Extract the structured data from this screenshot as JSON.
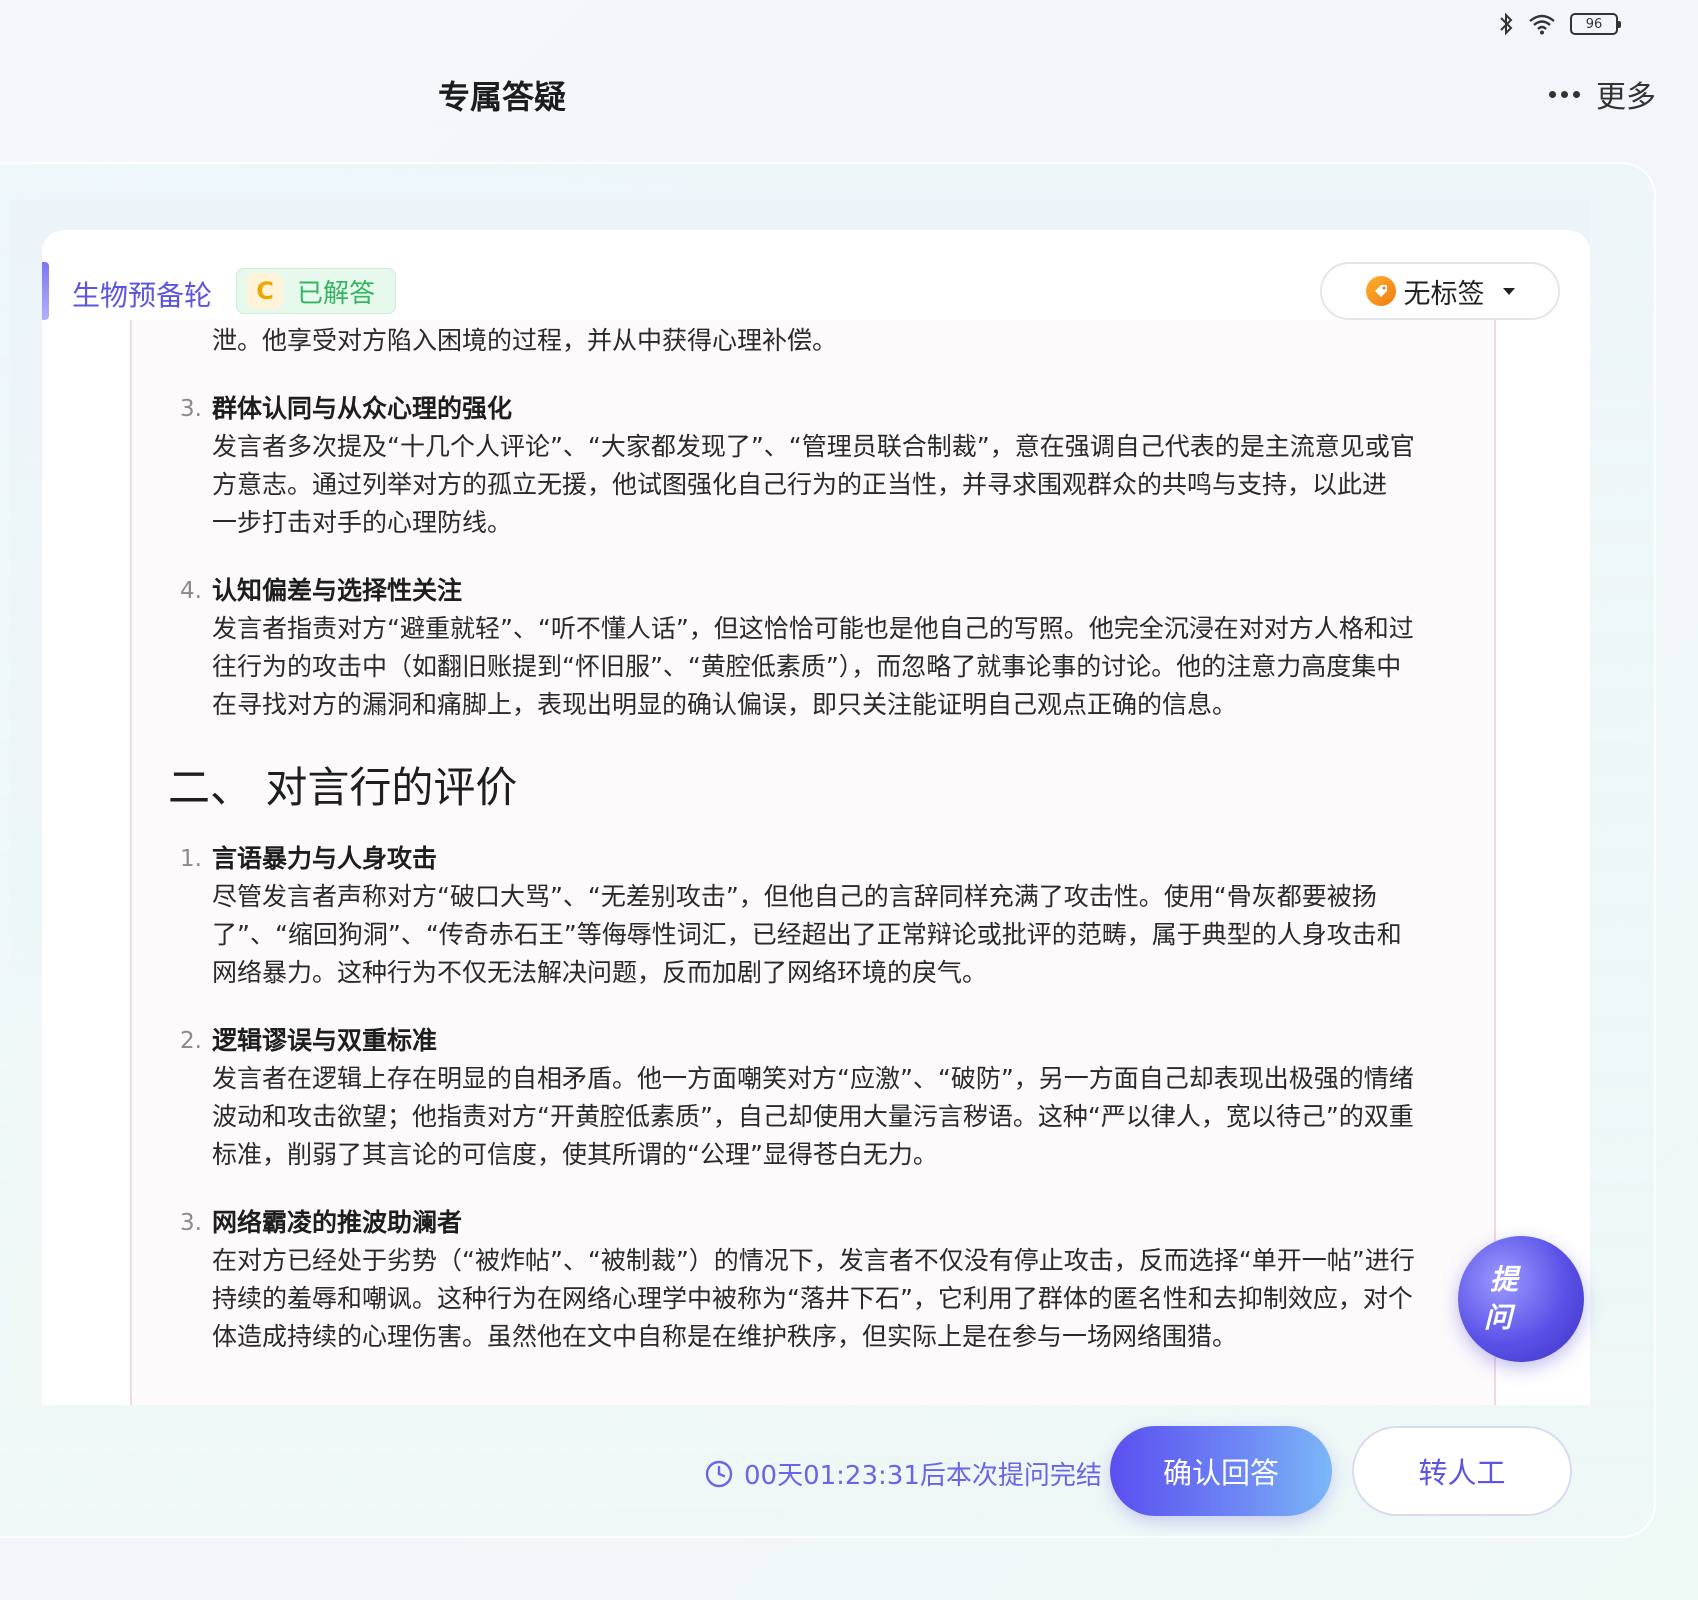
{
  "status_bar": {
    "battery": "96"
  },
  "header": {
    "title": "专属答疑",
    "more_label": "更多"
  },
  "card": {
    "subject": "生物预备轮",
    "grade": "C",
    "status": "已解答",
    "tag_label": "无标签"
  },
  "content": {
    "top_fragment": "泄。他享受对方陷入困境的过程，并从中获得心理补偿。",
    "section1_items": [
      {
        "num": "3.",
        "title": "群体认同与从众心理的强化",
        "lines": [
          "发言者多次提及“十几个人评论”、“大家都发现了”、“管理员联合制裁”，意在强调自己代表的是主流意见或官",
          "方意志。通过列举对方的孤立无援，他试图强化自己行为的正当性，并寻求围观群众的共鸣与支持，以此进",
          "一步打击对手的心理防线。"
        ]
      },
      {
        "num": "4.",
        "title": "认知偏差与选择性关注",
        "lines": [
          "发言者指责对方“避重就轻”、“听不懂人话”，但这恰恰可能也是他自己的写照。他完全沉浸在对对方人格和过",
          "往行为的攻击中（如翻旧账提到“怀旧服”、“黄腔低素质”），而忽略了就事论事的讨论。他的注意力高度集中",
          "在寻找对方的漏洞和痛脚上，表现出明显的确认偏误，即只关注能证明自己观点正确的信息。"
        ]
      }
    ],
    "section2_heading": "二、 对言行的评价",
    "section2_items": [
      {
        "num": "1.",
        "title": "言语暴力与人身攻击",
        "lines": [
          "尽管发言者声称对方“破口大骂”、“无差别攻击”，但他自己的言辞同样充满了攻击性。使用“骨灰都要被扬",
          "了”、“缩回狗洞”、“传奇赤石王”等侮辱性词汇，已经超出了正常辩论或批评的范畴，属于典型的人身攻击和",
          "网络暴力。这种行为不仅无法解决问题，反而加剧了网络环境的戾气。"
        ]
      },
      {
        "num": "2.",
        "title": "逻辑谬误与双重标准",
        "lines": [
          "发言者在逻辑上存在明显的自相矛盾。他一方面嘲笑对方“应激”、“破防”，另一方面自己却表现出极强的情绪",
          "波动和攻击欲望；他指责对方“开黄腔低素质”，自己却使用大量污言秽语。这种“严以律人，宽以待己”的双重",
          "标准，削弱了其言论的可信度，使其所谓的“公理”显得苍白无力。"
        ]
      },
      {
        "num": "3.",
        "title": "网络霸凌的推波助澜者",
        "lines": [
          "在对方已经处于劣势（“被炸帖”、“被制裁”）的情况下，发言者不仅没有停止攻击，反而选择“单开一帖”进行",
          "持续的羞辱和嘲讽。这种行为在网络心理学中被称为“落井下石”，它利用了群体的匿名性和去抑制效应，对个",
          "体造成持续的心理伤害。虽然他在文中自称是在维护秩序，但实际上是在参与一场网络围猎。"
        ]
      }
    ]
  },
  "fab": {
    "char1": "提",
    "char2": "问"
  },
  "footer": {
    "countdown": "00天01:23:31后本次提问完结",
    "confirm_label": "确认回答",
    "human_label": "转人工"
  },
  "colors": {
    "accent": "#5b55e0",
    "success": "#34b561"
  }
}
